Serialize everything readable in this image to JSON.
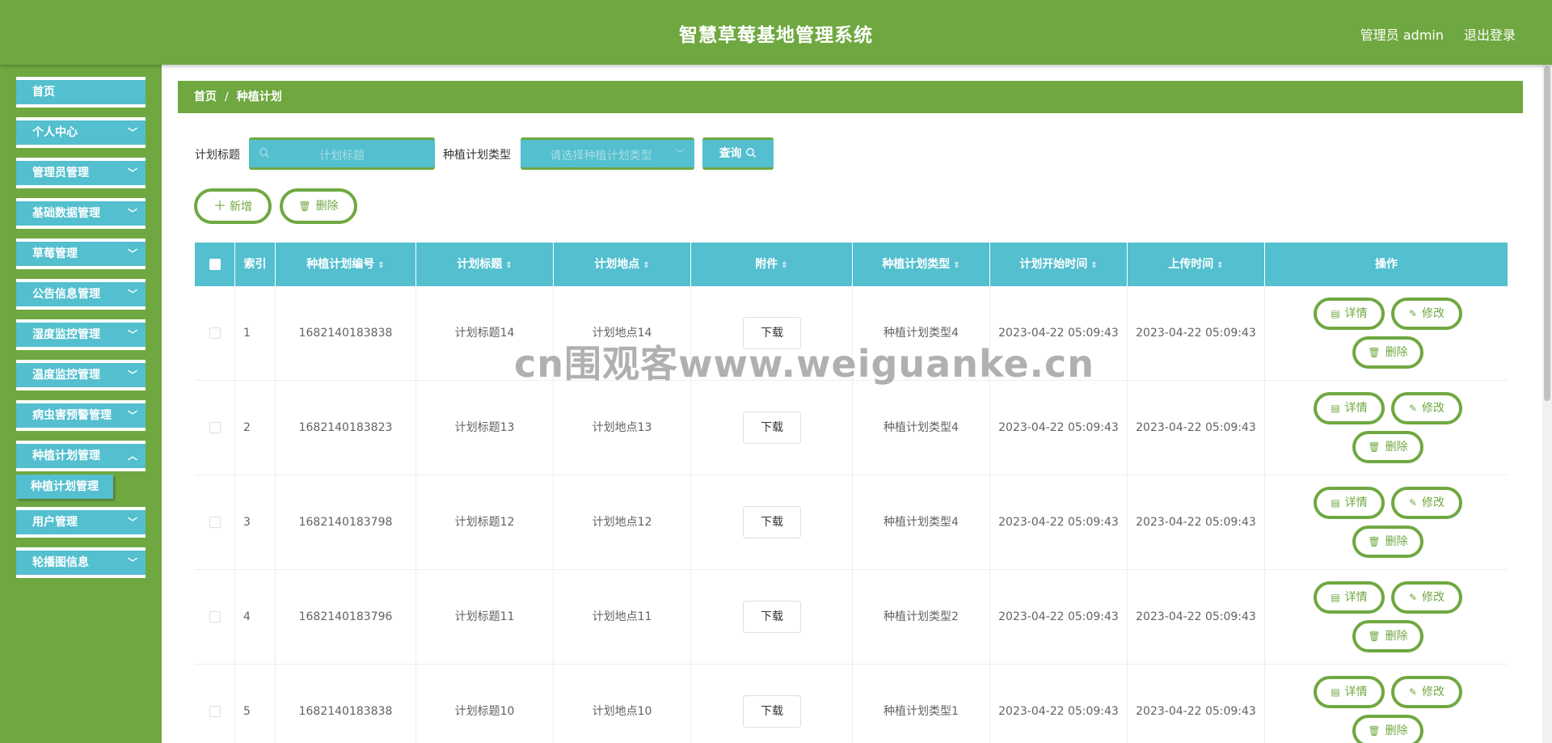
{
  "header": {
    "title": "智慧草莓基地管理系统",
    "user": "管理员 admin",
    "logout": "退出登录"
  },
  "sidebar": {
    "items": [
      {
        "label": "首页",
        "chevron": ""
      },
      {
        "label": "个人中心",
        "chevron": "﹀"
      },
      {
        "label": "管理员管理",
        "chevron": "﹀"
      },
      {
        "label": "基础数据管理",
        "chevron": "﹀"
      },
      {
        "label": "草莓管理",
        "chevron": "﹀"
      },
      {
        "label": "公告信息管理",
        "chevron": "﹀"
      },
      {
        "label": "湿度监控管理",
        "chevron": "﹀"
      },
      {
        "label": "温度监控管理",
        "chevron": "﹀"
      },
      {
        "label": "病虫害预警管理",
        "chevron": "﹀"
      },
      {
        "label": "种植计划管理",
        "chevron": "︿"
      },
      {
        "label": "用户管理",
        "chevron": "﹀"
      },
      {
        "label": "轮播图信息",
        "chevron": "﹀"
      }
    ],
    "sub_item": "种植计划管理"
  },
  "breadcrumb": {
    "home": "首页",
    "sep": "/",
    "current": "种植计划"
  },
  "search": {
    "title_label": "计划标题",
    "title_placeholder": "计划标题",
    "type_label": "种植计划类型",
    "type_placeholder": "请选择种植计划类型",
    "query_label": "查询"
  },
  "actions": {
    "add": "新增",
    "delete": "删除"
  },
  "table": {
    "columns": [
      "索引",
      "种植计划编号",
      "计划标题",
      "计划地点",
      "附件",
      "种植计划类型",
      "计划开始时间",
      "上传时间",
      "操作"
    ],
    "sort_icon": "⇕",
    "rows": [
      {
        "index": "1",
        "id": "1682140183838",
        "title": "计划标题14",
        "place": "计划地点14",
        "attach": "下载",
        "type": "种植计划类型4",
        "start": "2023-04-22 05:09:43",
        "upload": "2023-04-22 05:09:43"
      },
      {
        "index": "2",
        "id": "1682140183823",
        "title": "计划标题13",
        "place": "计划地点13",
        "attach": "下载",
        "type": "种植计划类型4",
        "start": "2023-04-22 05:09:43",
        "upload": "2023-04-22 05:09:43"
      },
      {
        "index": "3",
        "id": "1682140183798",
        "title": "计划标题12",
        "place": "计划地点12",
        "attach": "下载",
        "type": "种植计划类型4",
        "start": "2023-04-22 05:09:43",
        "upload": "2023-04-22 05:09:43"
      },
      {
        "index": "4",
        "id": "1682140183796",
        "title": "计划标题11",
        "place": "计划地点11",
        "attach": "下载",
        "type": "种植计划类型2",
        "start": "2023-04-22 05:09:43",
        "upload": "2023-04-22 05:09:43"
      },
      {
        "index": "5",
        "id": "1682140183838",
        "title": "计划标题10",
        "place": "计划地点10",
        "attach": "下载",
        "type": "种植计划类型1",
        "start": "2023-04-22 05:09:43",
        "upload": "2023-04-22 05:09:43"
      }
    ],
    "row_actions": {
      "detail": "详情",
      "edit": "修改",
      "delete": "删除"
    }
  },
  "icons": {
    "search": "search-icon",
    "plus": "plus-icon",
    "trash": "trash-icon",
    "document": "document-icon",
    "pencil": "pencil-icon"
  },
  "watermark": "cn围观客www.weiguanke.cn",
  "colors": {
    "primary_green": "#6fa840",
    "accent_cyan": "#53bfcf"
  }
}
